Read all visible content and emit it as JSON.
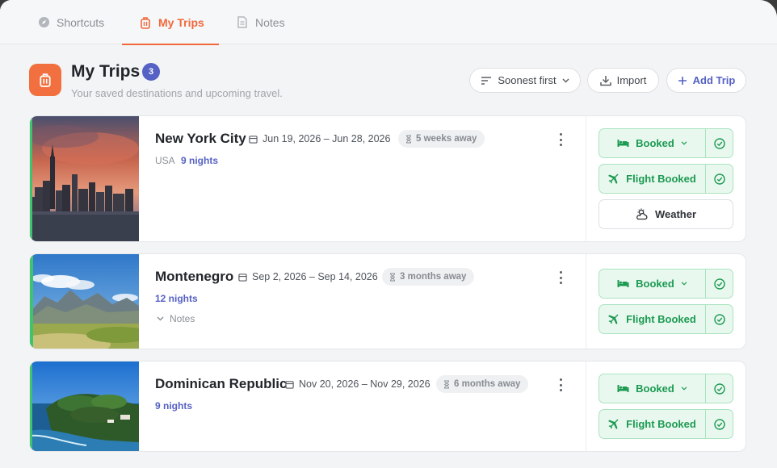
{
  "tabs": [
    {
      "label": "Shortcuts",
      "icon": "compass-icon",
      "active": false
    },
    {
      "label": "My Trips",
      "icon": "luggage-icon",
      "active": true
    },
    {
      "label": "Notes",
      "icon": "document-icon",
      "active": false
    }
  ],
  "header": {
    "title": "My Trips",
    "count": "3",
    "subtitle": "Your saved destinations and upcoming travel."
  },
  "toolbar": {
    "sort_label": "Soonest first",
    "import_label": "Import",
    "add_label": "Add Trip"
  },
  "trips": [
    {
      "name": "New York City",
      "dates": "Jun 19, 2026 – Jun 28, 2026",
      "away": "5 weeks away",
      "country": "USA",
      "nights": "9 nights",
      "lodging_status": "Booked",
      "flight_status": "Flight Booked",
      "weather_label": "Weather"
    },
    {
      "name": "Montenegro",
      "dates": "Sep 2, 2026 – Sep 14, 2026",
      "away": "3 months away",
      "nights": "12 nights",
      "notes_label": "Notes",
      "lodging_status": "Booked",
      "flight_status": "Flight Booked"
    },
    {
      "name": "Dominican Republic",
      "dates": "Nov 20, 2026 – Nov 29, 2026",
      "away": "6 months away",
      "nights": "9 nights",
      "lodging_status": "Booked",
      "flight_status": "Flight Booked"
    }
  ],
  "colors": {
    "accent": "#f0683c",
    "primary": "#5561c4",
    "success": "#1c9a52",
    "status_border": "#3ec46d"
  }
}
